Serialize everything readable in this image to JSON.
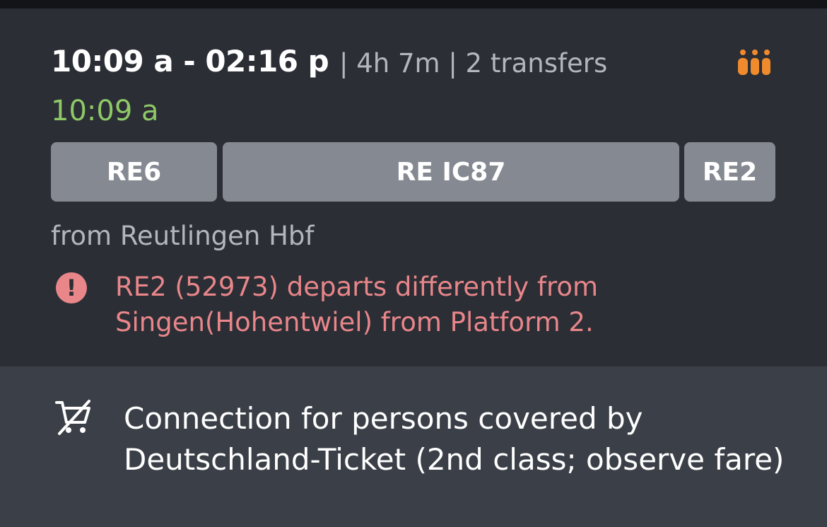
{
  "connection": {
    "time_range": "10:09 a - 02:16 p",
    "meta": "| 4h 7m | 2 transfers",
    "realtime_departure": "10:09 a",
    "occupancy_icon": "occupancy-people-icon",
    "occupancy_color": "#f08b2d",
    "legs": [
      {
        "label": "RE6"
      },
      {
        "label": "RE IC87"
      },
      {
        "label": "RE2"
      }
    ],
    "origin": "from Reutlingen Hbf",
    "alert": {
      "icon": "alert-exclamation-icon",
      "color": "#e8868a",
      "text": "RE2 (52973) departs differently from Singen(Hohentwiel) from Platform 2."
    }
  },
  "notice": {
    "icon": "no-shopping-cart-icon",
    "text": "Connection for persons covered by Deutschland-Ticket (2nd class; observe fare)"
  }
}
